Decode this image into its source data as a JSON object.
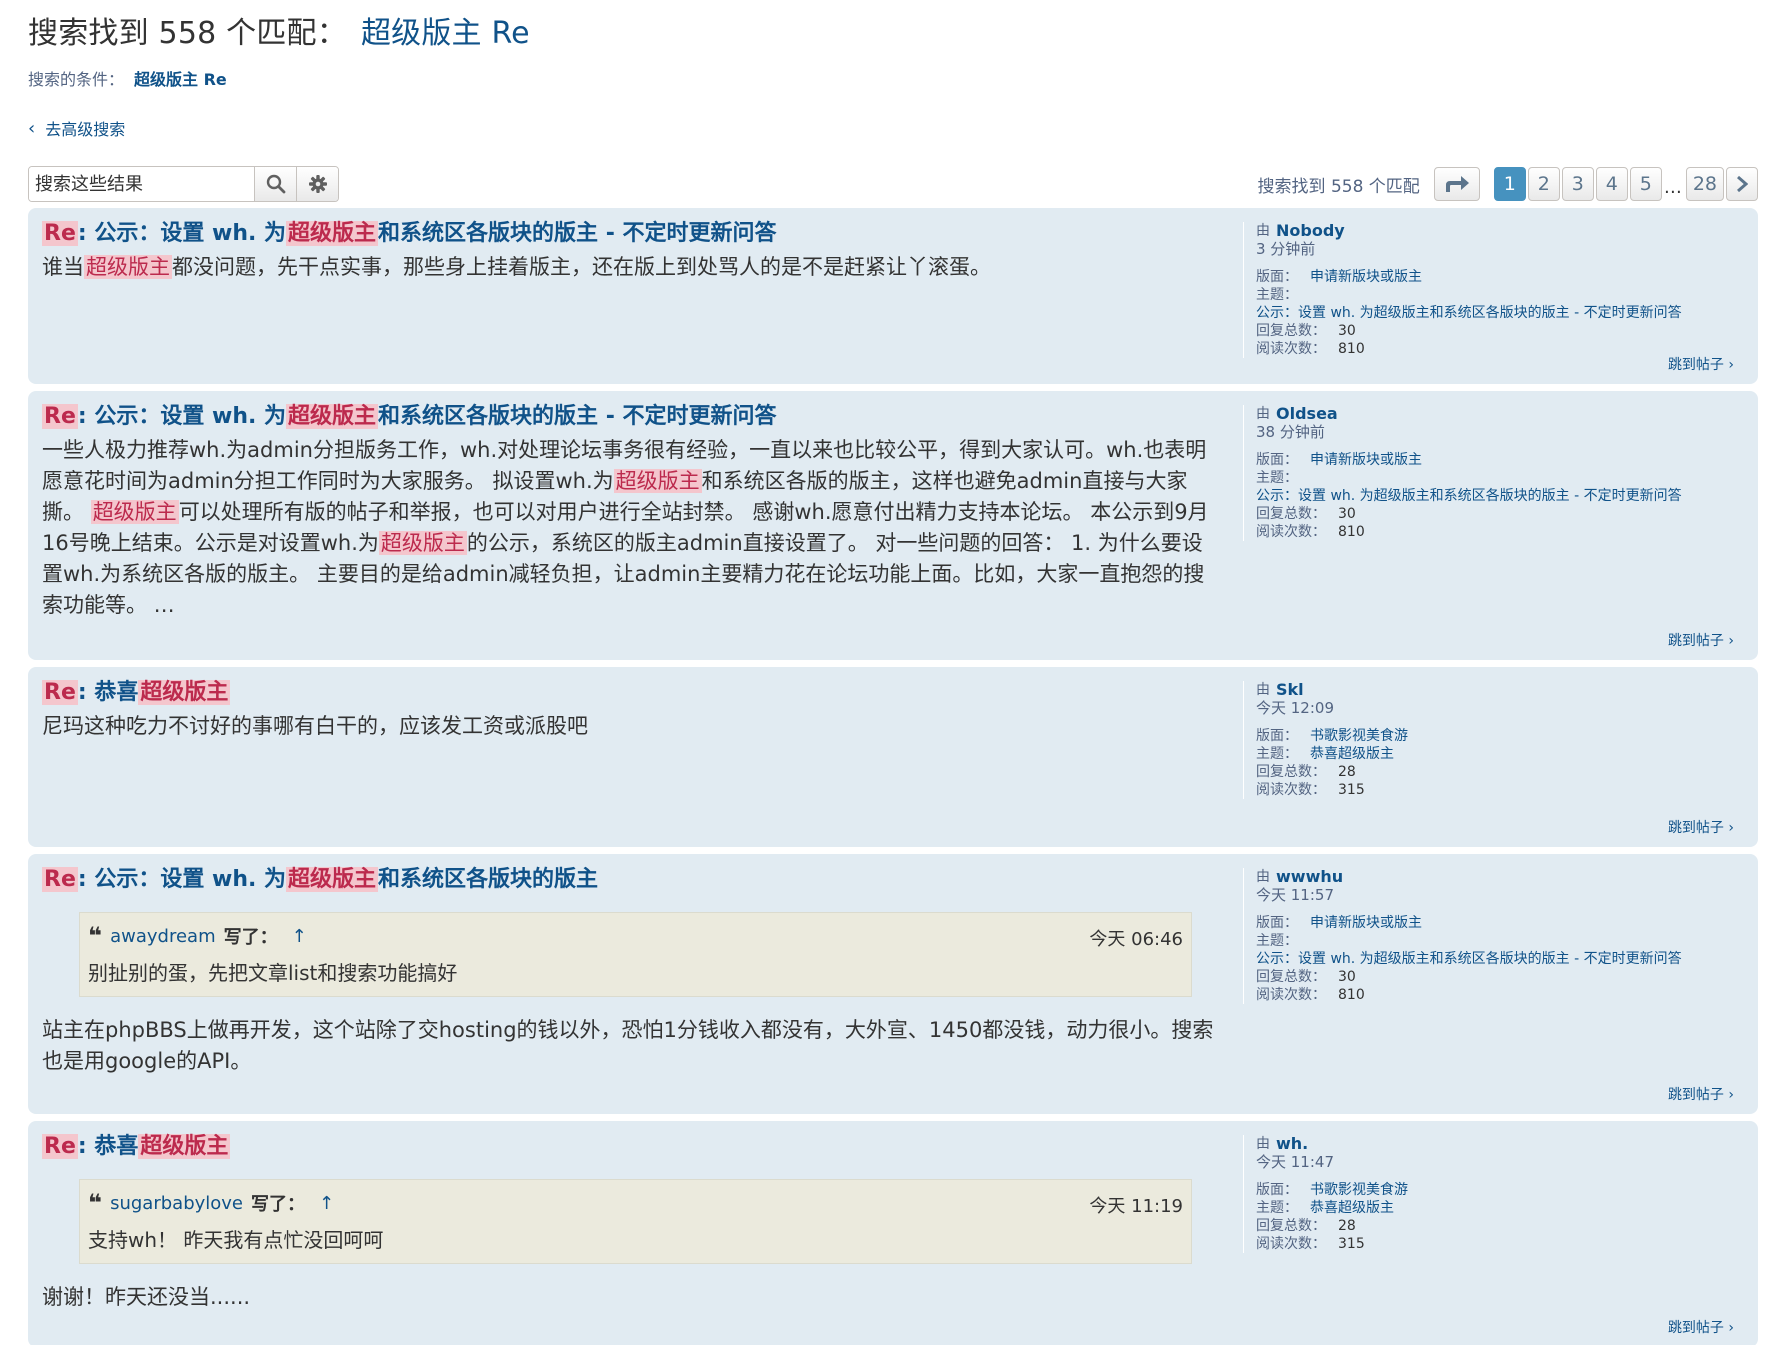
{
  "header": {
    "title_prefix": "搜索找到 558 个匹配：",
    "title_keyword": "超级版主 Re",
    "criteria_label": "搜索的条件：",
    "criteria_value": "超级版主 Re",
    "advanced_search_link": "去高级搜索"
  },
  "toolbar": {
    "search_placeholder": "搜索这些结果",
    "search_icon": "search-icon",
    "settings_icon": "gear-icon",
    "match_count": "搜索找到 558 个匹配",
    "pages": [
      "1",
      "2",
      "3",
      "4",
      "5"
    ],
    "ellipsis": "…",
    "last_page": "28",
    "current_page": "1"
  },
  "labels": {
    "forum": "版面：",
    "topic": "主题：",
    "replies": "回复总数：",
    "views": "阅读次数：",
    "jump": "跳到帖子 ›",
    "wrote": "写了：",
    "re": "Re",
    "colon": ": ",
    "by": "由"
  },
  "posts": [
    {
      "title_pre": "公示：设置 wh. 为",
      "title_hl": "超级版主",
      "title_post": "和系统区各版块的版主 - 不定时更新问答",
      "content_pre": "谁当",
      "content_hl": "超级版主",
      "content_post": "都没问题，先干点实事，那些身上挂着版主，还在版上到处骂人的是不是赶紧让丫滚蛋。",
      "author": "Nobody",
      "time": "3 分钟前",
      "forum": "申请新版块或版主",
      "topic": "公示：设置 wh. 为超级版主和系统区各版块的版主 - 不定时更新问答",
      "replies": "30",
      "views": "810"
    },
    {
      "title_pre": "公示：设置 wh. 为",
      "title_hl": "超级版主",
      "title_post": "和系统区各版块的版主 - 不定时更新问答",
      "c1": "一些人极力推荐wh.为admin分担版务工作，wh.对处理论坛事务很有经验，一直以来也比较公平，得到大家认可。wh.也表明愿意花时间为admin分担工作同时为大家服务。 拟设置wh.为",
      "h1": "超级版主",
      "c2": "和系统区各版的版主，这样也避免admin直接与大家撕。 ",
      "h2": "超级版主",
      "c3": "可以处理所有版的帖子和举报，也可以对用户进行全站封禁。 感谢wh.愿意付出精力支持本论坛。 本公示到9月16号晚上结束。公示是对设置wh.为",
      "h3": "超级版主",
      "c4": "的公示，系统区的版主admin直接设置了。 对一些问题的回答： 1. 为什么要设置wh.为系统区各版的版主。 主要目的是给admin减轻负担，让admin主要精力花在论坛功能上面。比如，大家一直抱怨的搜索功能等。 …",
      "author": "Oldsea",
      "time": "38 分钟前",
      "forum": "申请新版块或版主",
      "topic": "公示：设置 wh. 为超级版主和系统区各版块的版主 - 不定时更新问答",
      "replies": "30",
      "views": "810"
    },
    {
      "title_pre": "恭喜",
      "title_hl": "超级版主",
      "content": "尼玛这种吃力不讨好的事哪有白干的，应该发工资或派股吧",
      "author": "Skl",
      "time": "今天 12:09",
      "forum": "书歌影视美食游",
      "topic": "恭喜超级版主",
      "replies": "28",
      "views": "315"
    },
    {
      "title_pre": "公示：设置 wh. 为",
      "title_hl": "超级版主",
      "title_post": "和系统区各版块的版主",
      "quote_author": "awaydream",
      "quote_time": "今天 06:46",
      "quote_text": "别扯别的蛋，先把文章list和搜索功能搞好",
      "content": "站主在phpBBS上做再开发，这个站除了交hosting的钱以外，恐怕1分钱收入都没有，大外宣、1450都没钱，动力很小。搜索也是用google的API。",
      "author": "wwwhu",
      "time": "今天 11:57",
      "forum": "申请新版块或版主",
      "topic": "公示：设置 wh. 为超级版主和系统区各版块的版主 - 不定时更新问答",
      "replies": "30",
      "views": "810"
    },
    {
      "title_pre": "恭喜",
      "title_hl": "超级版主",
      "quote_author": "sugarbabylove",
      "quote_time": "今天 11:19",
      "quote_text": "支持wh！ 昨天我有点忙没回呵呵",
      "content": "谢谢！昨天还没当......",
      "author": "wh.",
      "time": "今天 11:47",
      "forum": "书歌影视美食游",
      "topic": "恭喜超级版主",
      "replies": "28",
      "views": "315"
    }
  ]
}
